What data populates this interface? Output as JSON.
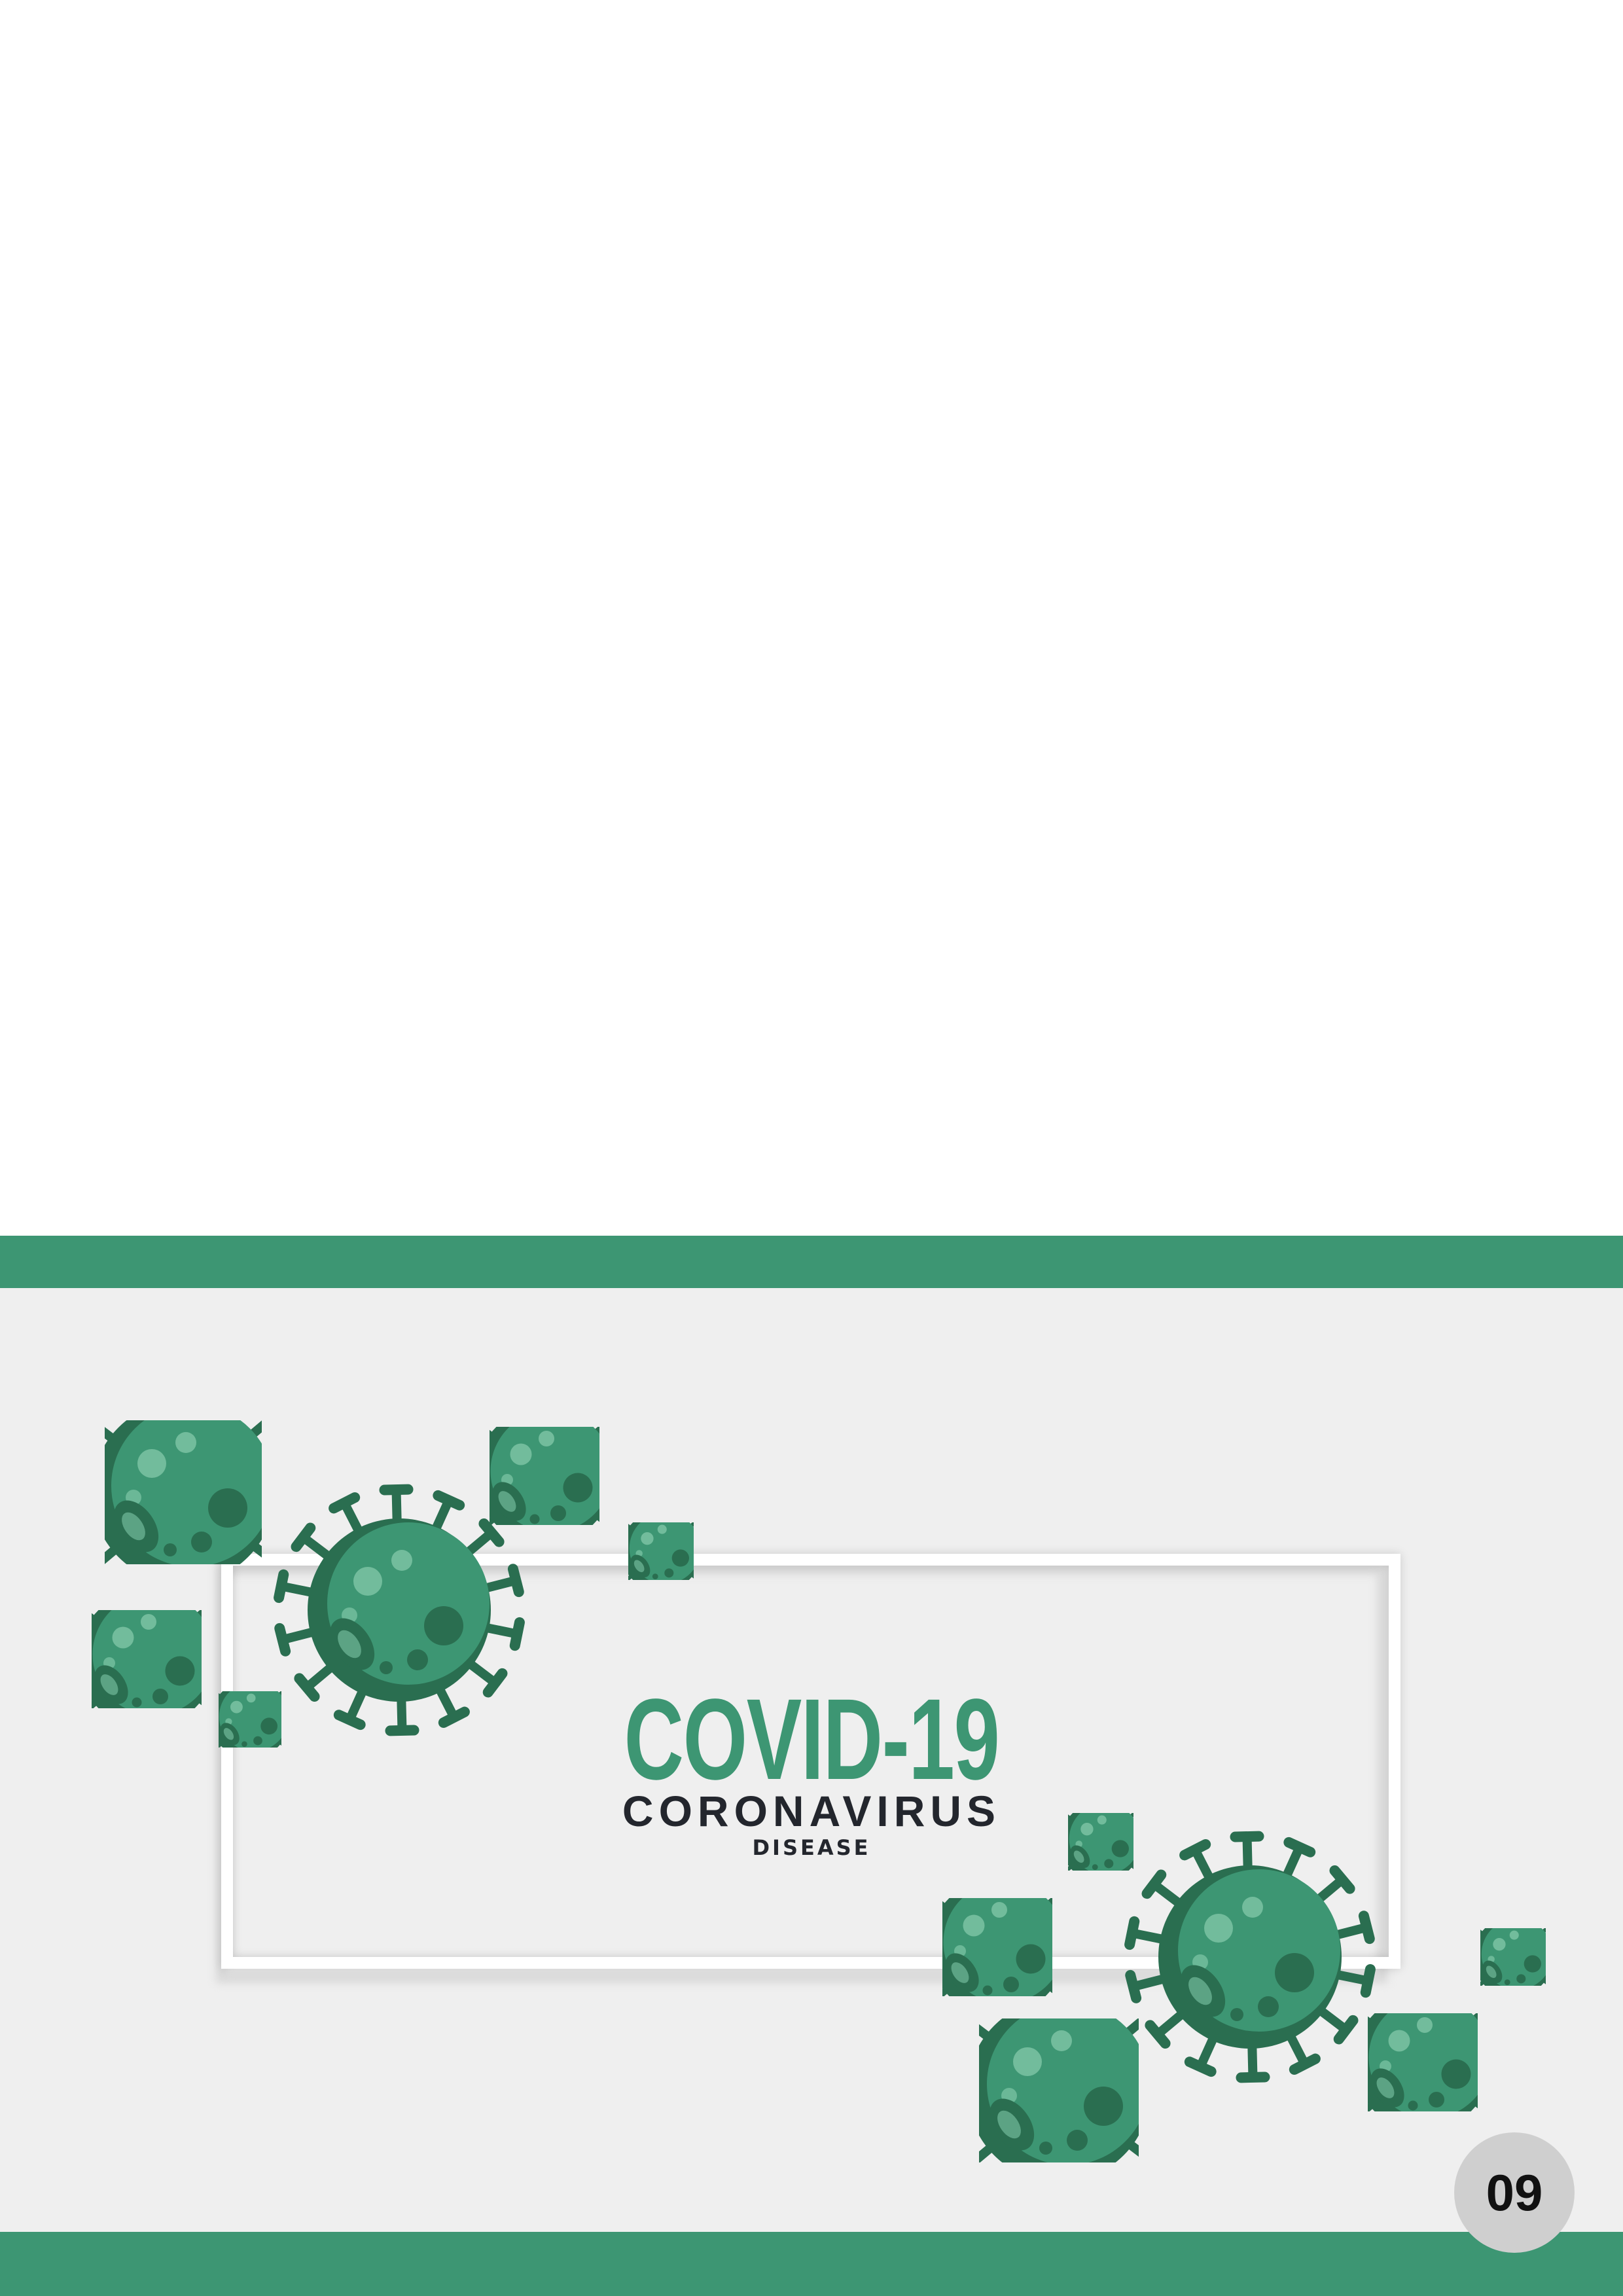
{
  "colors": {
    "brand_green": "#3d9673",
    "virus_body": "#3d9673",
    "virus_dark": "#2a6e50",
    "virus_light": "#7fc6a6",
    "text_dark": "#23262d",
    "panel_bg": "#efefef",
    "badge_bg": "#cfcfcf"
  },
  "banner": {
    "title": "COVID-19",
    "subtitle": "CORONAVIRUS",
    "caption": "DISEASE"
  },
  "page": {
    "number": "09"
  },
  "decoration": {
    "icon": "coronavirus-icon"
  }
}
